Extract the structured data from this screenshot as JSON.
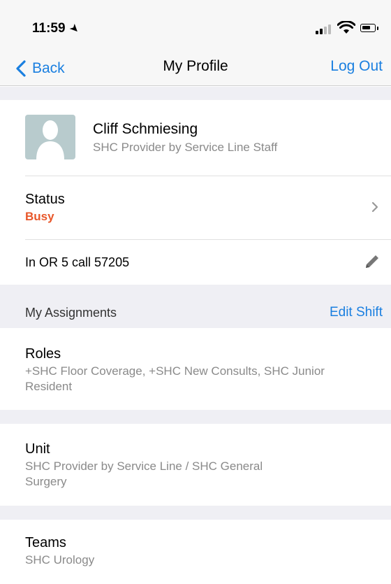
{
  "status_bar": {
    "time": "11:59",
    "location_icon": "location-arrow-icon"
  },
  "nav": {
    "back_label": "Back",
    "title": "My Profile",
    "logout_label": "Log Out"
  },
  "profile": {
    "name": "Cliff Schmiesing",
    "role": "SHC Provider by Service Line Staff"
  },
  "status": {
    "label": "Status",
    "value": "Busy",
    "value_color": "#e8572a"
  },
  "note": {
    "text": "In OR 5 call 57205"
  },
  "assignments": {
    "header": "My Assignments",
    "edit_label": "Edit Shift",
    "roles": {
      "title": "Roles",
      "text": "+SHC Floor Coverage, +SHC New Consults, SHC Junior Resident"
    },
    "unit": {
      "title": "Unit",
      "text": "SHC Provider by Service Line / SHC General Surgery"
    },
    "teams": {
      "title": "Teams",
      "text": "SHC Urology"
    }
  },
  "colors": {
    "accent": "#1a7fe0",
    "busy": "#e8572a",
    "background": "#efeff4"
  }
}
